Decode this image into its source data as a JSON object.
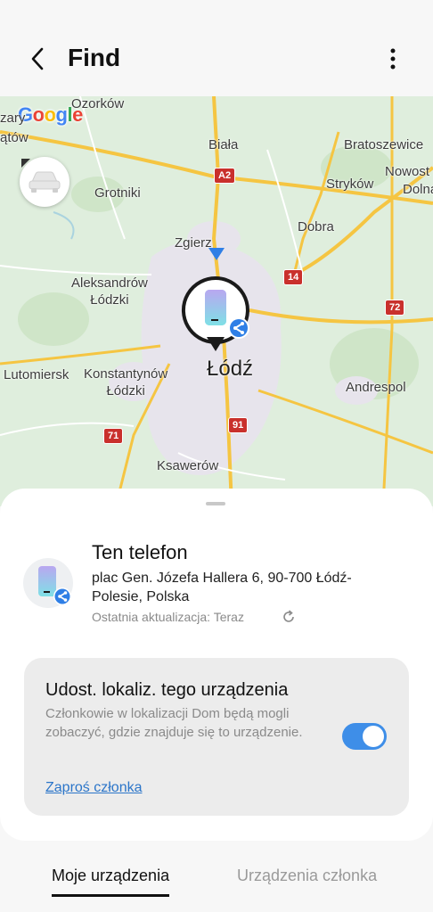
{
  "header": {
    "title": "Find",
    "back_icon": "chevron-left-icon",
    "menu_icon": "more-vertical-icon"
  },
  "map": {
    "logo": "Google",
    "labels": {
      "ozorkow": "Ozorków",
      "zgierz_partial_left": "zary",
      "zgierz_partial_left2": "ątów",
      "biala": "Biała",
      "bratoszewice": "Bratoszewice",
      "nowosolna": "Nowost",
      "dolna": "Dolna",
      "grotniki": "Grotniki",
      "strykow": "Stryków",
      "zgierz": "Zgierz",
      "dobra": "Dobra",
      "aleksandrow": "Aleksandrów\nŁódzki",
      "lodz": "Łódź",
      "lutomiersk": "Lutomiersk",
      "konstantynow": "Konstantynów\nŁódzki",
      "andrespol": "Andrespol",
      "ksawerow": "Ksawerów"
    },
    "shields": {
      "a2": "A2",
      "r14": "14",
      "r72": "72",
      "r91": "91",
      "r71": "71"
    },
    "colors": {
      "land": "#dfeedd",
      "road": "#f5c542",
      "urban": "#e7e4ec",
      "water": "#aad3df",
      "shield": "#c9302c"
    }
  },
  "device": {
    "name": "Ten telefon",
    "address": "plac Gen. Józefa Hallera 6, 90-700 Łódź-Polesie, Polska",
    "updated": "Ostatnia aktualizacja: Teraz"
  },
  "share": {
    "title": "Udost. lokaliz. tego urządzenia",
    "description": "Członkowie w lokalizacji Dom będą mogli zobaczyć, gdzie znajduje się to urządzenie.",
    "toggle_on": true,
    "invite_label": "Zaproś członka"
  },
  "tabs": {
    "active": "Moje urządzenia",
    "inactive": "Urządzenia członka"
  },
  "colors": {
    "accent": "#3e8ee8",
    "link": "#2b75c9"
  }
}
